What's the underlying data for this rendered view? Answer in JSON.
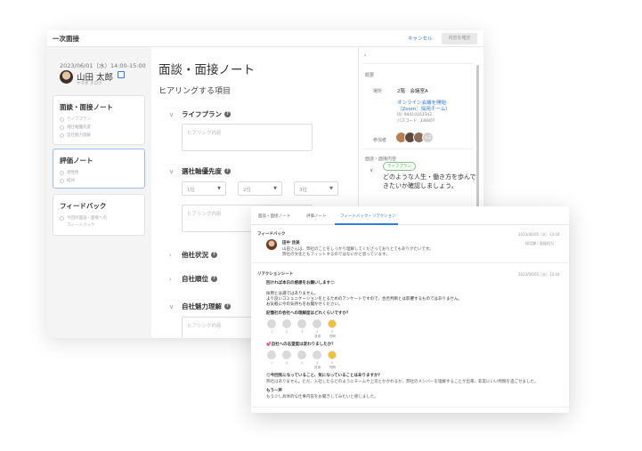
{
  "window": {
    "title": "一次面接",
    "cancel_label": "キャンセル",
    "save_label": "内容を確定"
  },
  "sidebar": {
    "datetime": "2023/06/01（水）14:00-15:00",
    "user_name": "山田 太郎",
    "user_kana": "ヤマダ タロウ",
    "cards": [
      {
        "title": "面談・面接ノート",
        "items": [
          "ライフプラン",
          "選社軸優先度",
          "自社魅力理解"
        ]
      },
      {
        "title": "評価ノート",
        "items": [
          "適性性",
          "総評"
        ]
      },
      {
        "title": "フィードバック",
        "items": [
          "今回の面談・面接への",
          "フィードバック"
        ]
      }
    ]
  },
  "main": {
    "title": "面談・面接ノート",
    "subtitle": "ヒアリングする項目",
    "placeholder": "ヒアリング内容",
    "sections": [
      "ライフプラン",
      "選社軸優先度",
      "他社状況",
      "自社順位",
      "自社魅力理解"
    ],
    "selects": [
      "1位",
      "2位",
      "3位"
    ]
  },
  "details": {
    "overview_label": "概要",
    "place_label": "場所",
    "place_value": "2階　会議室A",
    "online_link": "オンライン会議を開始",
    "online_sub": "（Zoom：採用チーム）",
    "meeting_id": "ID: 98410163342",
    "passcode": "パスコード: 338807",
    "participants_label": "参加者",
    "participants_extra": "+2",
    "notes_label": "面談・面接内容",
    "tag": "ライフプラン",
    "body_line1": "どのような人生・働き方を歩んで",
    "body_line2": "きたいか確認しましょう。"
  },
  "feedback": {
    "tabs": [
      "面談・面接ノート",
      "評価ノート",
      "フィードバック・リアクション"
    ],
    "fb_heading": "フィードバック",
    "fb_date": "2023/06/05（水）13:04",
    "fb_author": "田中 佳美",
    "fb_role": "採用課 / 面接担当",
    "fb_line1": "山田さんは、弊社のことをしっかり理解してくださっておりとてもありがたいです。",
    "fb_line2": "弊社の文化ともフィットするのではないかと思っています。",
    "rs_heading": "リアクションシート",
    "rs_date": "2023/06/05（水）13:04",
    "rs_intro": "回ければ本日の感想をお願いします😊",
    "rs_l1": "採用とは選ではありません。",
    "rs_l2": "より良いコミュニケーションをとるためのアンケートですので、合否判断とは影響するものではありません。",
    "rs_l3": "お気軽に今の気持ちをお聞かせください。",
    "rs_q1": "記憶社の会社への理解度はどれくらいですか？",
    "rs_q2": "💕自社への志望度は変わりましたか？",
    "rs_q3": "😊今回気になっていること、気になっていることはありますか？",
    "rs_a3": "弊社はありません。ただ、入社したらどのようにチームや上司とかかわるか、弊社のメンバーを理解することが出来、非常にいい時間を過ごせました。",
    "rs_q4": "もう一声",
    "rs_a4": "もう少し具体的な仕事内容をお聞きしてみたいと感じました。",
    "scale": [
      "1",
      "2",
      "3",
      "4",
      "5"
    ],
    "scale_low": "普通",
    "scale_high": "理解"
  }
}
